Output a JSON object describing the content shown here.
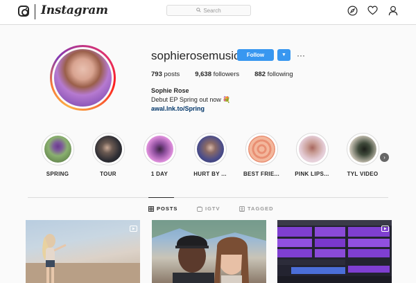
{
  "header": {
    "wordmark": "Instagram",
    "search_placeholder": "Search"
  },
  "profile": {
    "username": "sophierosemusic",
    "follow_label": "Follow",
    "more_label": "···",
    "posts_count": "793",
    "posts_label": "posts",
    "followers_count": "9,638",
    "followers_label": "followers",
    "following_count": "882",
    "following_label": "following",
    "full_name": "Sophie Rose",
    "bio": "Debut EP Spring out now 💐",
    "link": "awal.lnk.to/Spring"
  },
  "highlights": [
    {
      "label": "SPRING",
      "color": "#5a7d4a"
    },
    {
      "label": "TOUR",
      "color": "#2e2e34"
    },
    {
      "label": "1 DAY",
      "color": "#c86bc9"
    },
    {
      "label": "HURT BY ...",
      "color": "#4b4d8a"
    },
    {
      "label": "BEST FRIE...",
      "color": "#e98f73"
    },
    {
      "label": "PINK LIPS...",
      "color": "#d9b6c6"
    },
    {
      "label": "TYL VIDEO",
      "color": "#3f4a3a"
    }
  ],
  "tabs": [
    {
      "label": "POSTS",
      "active": true
    },
    {
      "label": "IGTV",
      "active": false
    },
    {
      "label": "TAGGED",
      "active": false
    }
  ],
  "colors": {
    "accent": "#3897f0",
    "link": "#003569"
  }
}
